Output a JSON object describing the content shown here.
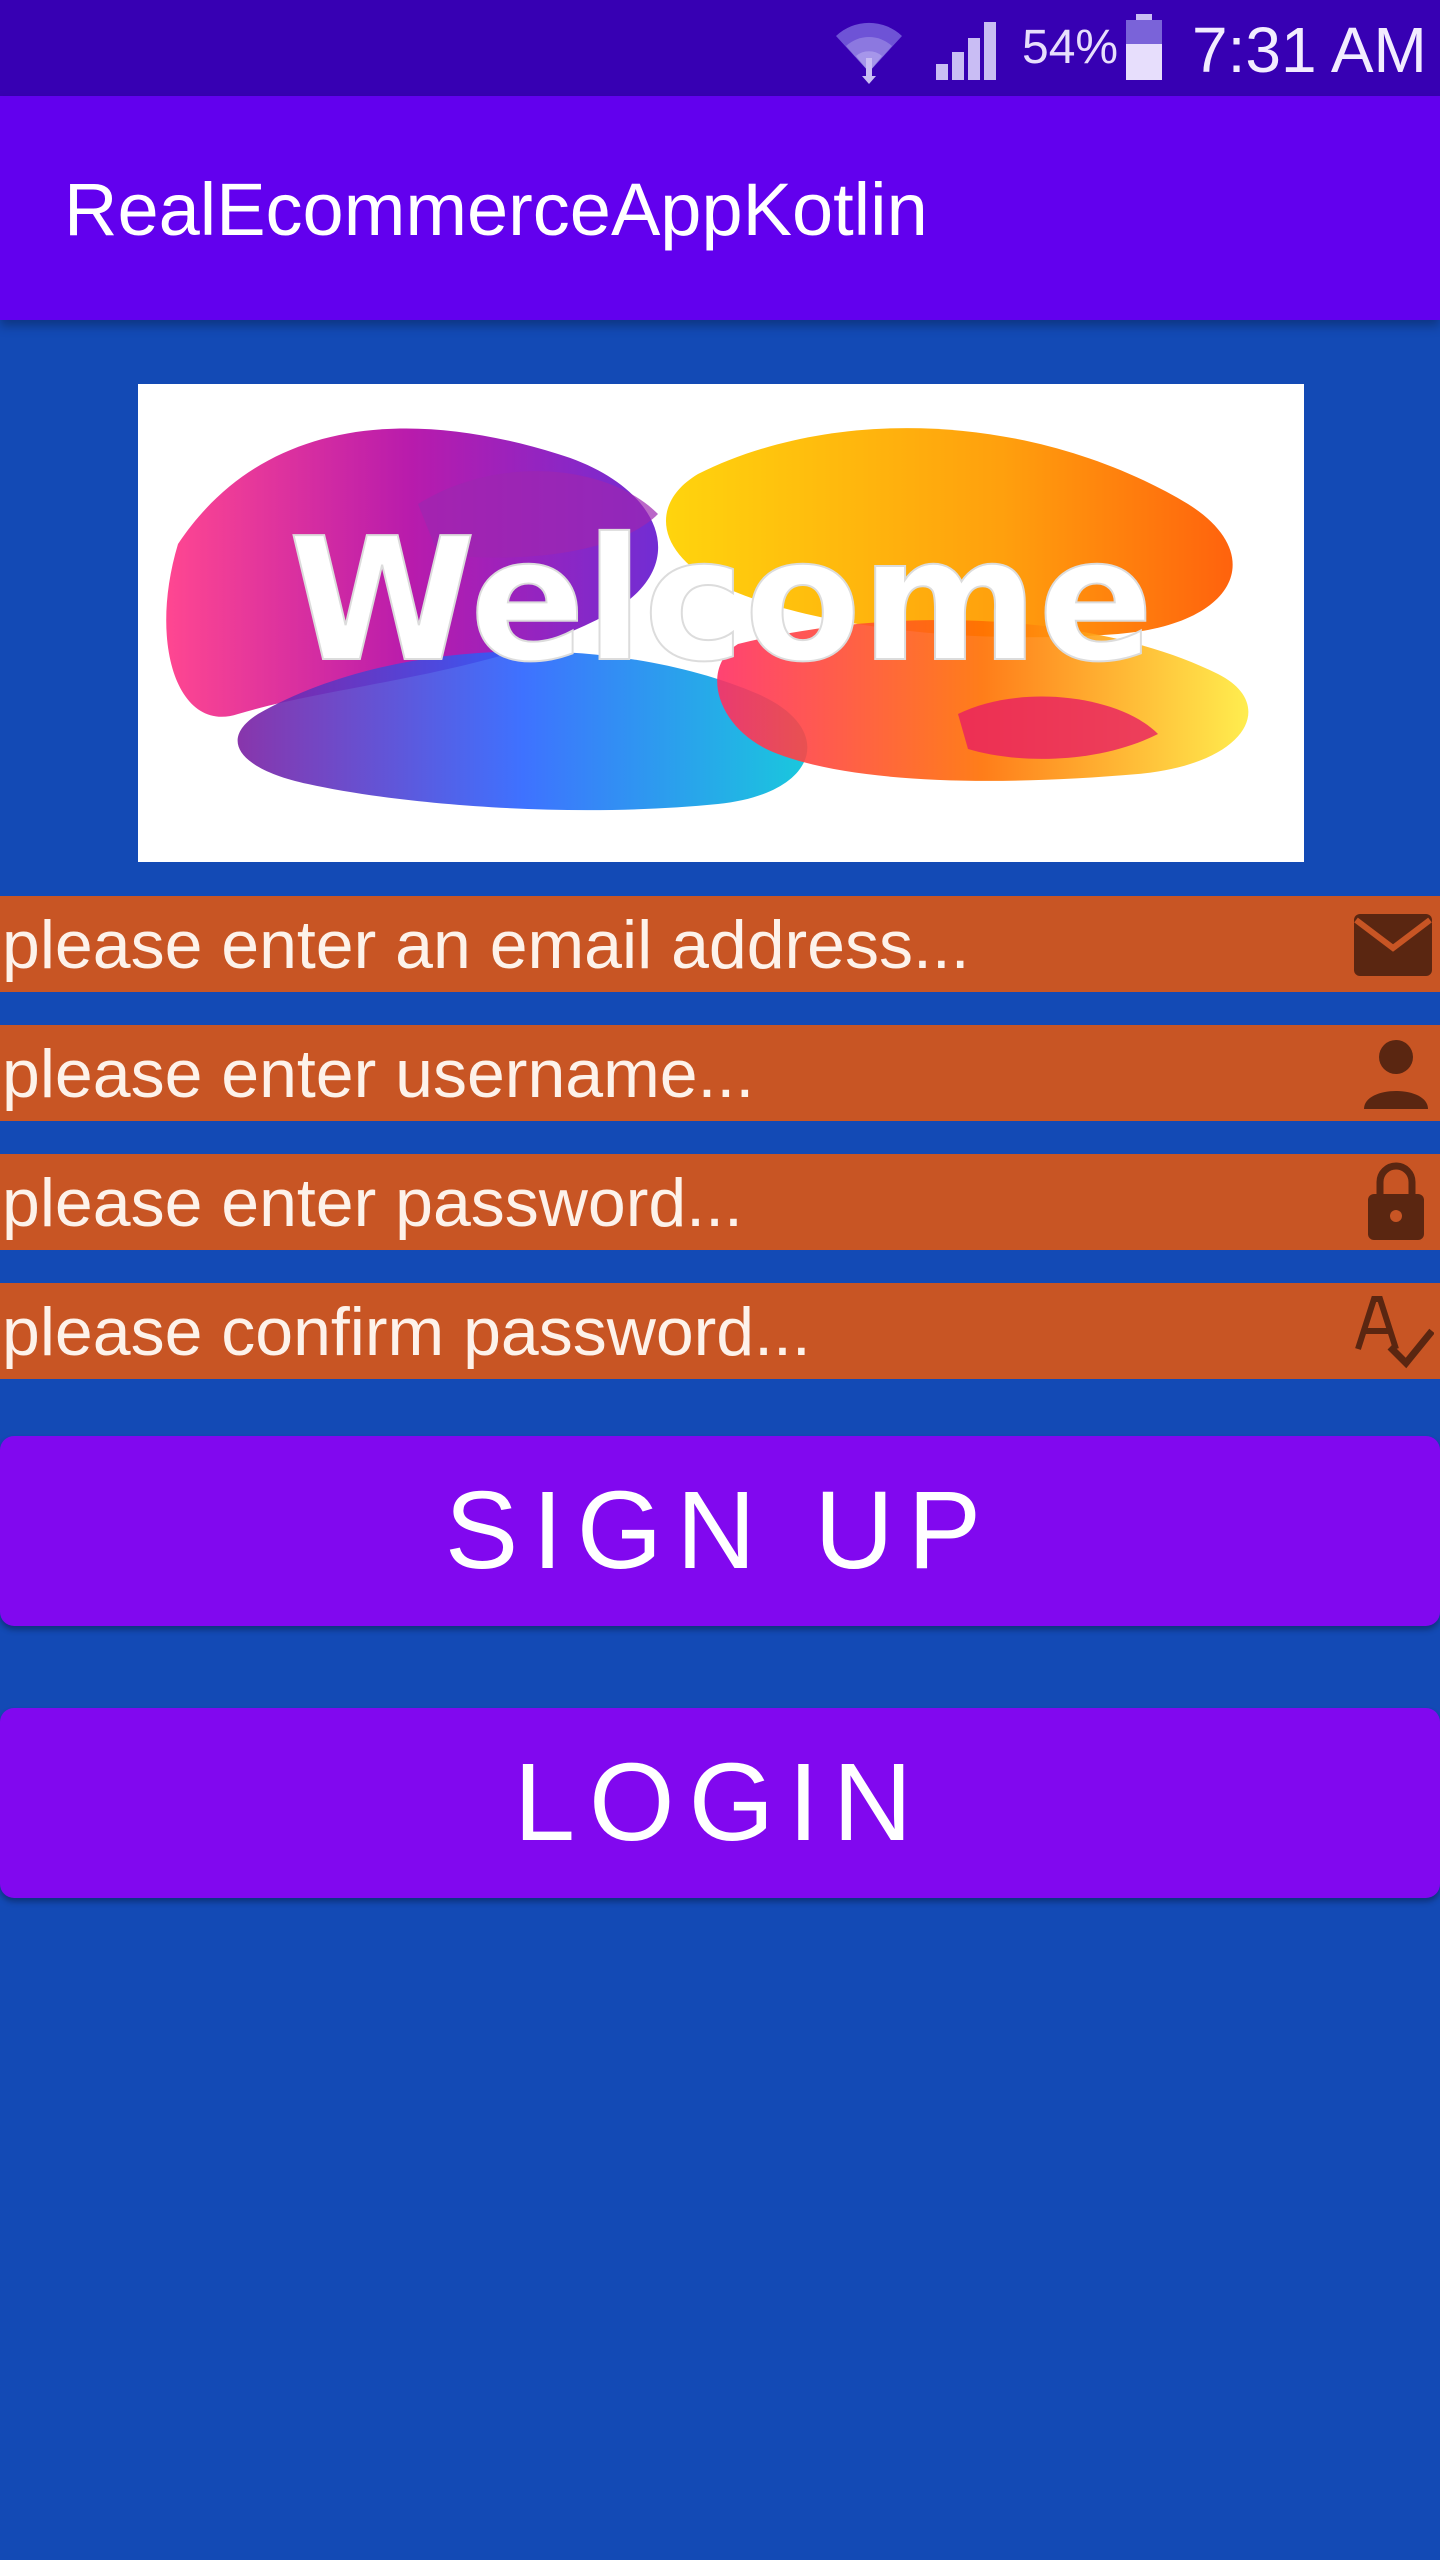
{
  "status_bar": {
    "battery": "54%",
    "time": "7:31 AM"
  },
  "app_bar": {
    "title": "RealEcommerceAppKotlin"
  },
  "welcome_image": {
    "text": "Welcome"
  },
  "form": {
    "email_placeholder": "please enter an email address...",
    "username_placeholder": "please enter username...",
    "password_placeholder": "please enter password...",
    "confirm_placeholder": "please confirm password...",
    "field_color": "#c85524",
    "icon_color": "#5a2611"
  },
  "buttons": {
    "signup_label": "SIGN UP",
    "login_label": "LOGIN",
    "button_color": "#8108ef"
  },
  "icons": {
    "email": "email-icon",
    "username": "person-icon",
    "password": "lock-icon",
    "confirm": "spellcheck-icon"
  },
  "theme": {
    "background": "#134ab5",
    "status_bar": "#3700b3",
    "app_bar": "#6200ee"
  }
}
